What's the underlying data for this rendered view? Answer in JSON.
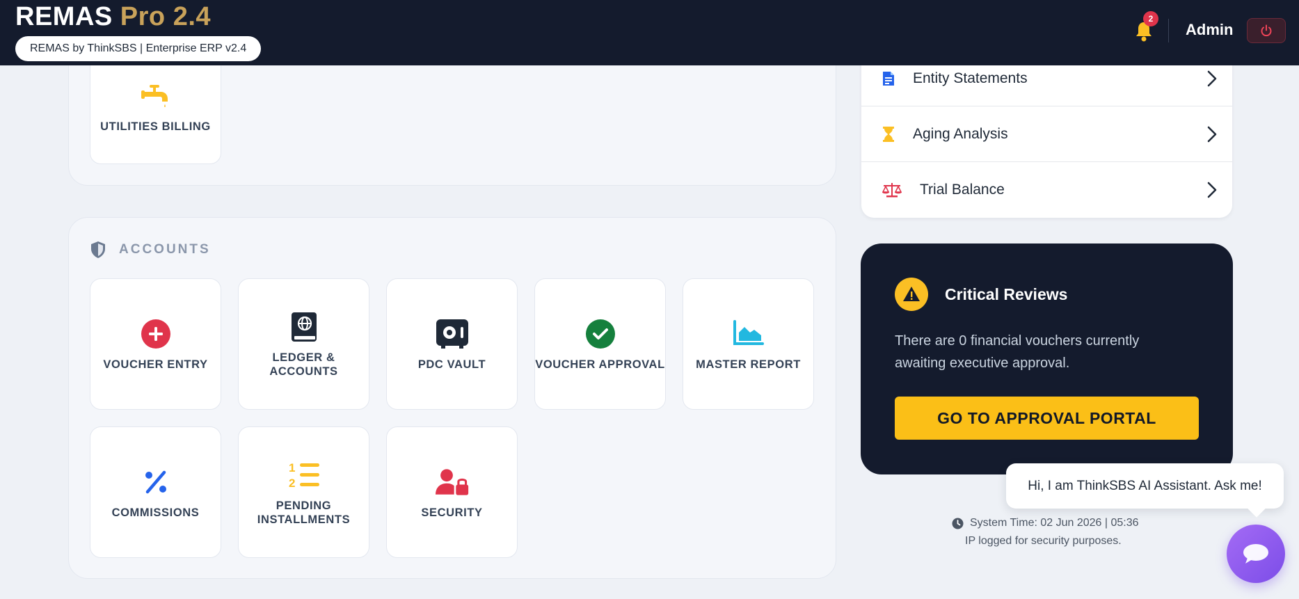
{
  "header": {
    "brand_name": "REMAS",
    "brand_version": "Pro 2.4",
    "brand_subtitle": "REMAS by ThinkSBS | Enterprise ERP v2.4",
    "notification_count": "2",
    "user_name": "Admin"
  },
  "top_section": {
    "tiles": [
      {
        "label": "UTILITIES BILLING",
        "icon": "faucet-icon",
        "color": "#fbbf24"
      }
    ]
  },
  "accounts": {
    "title": "ACCOUNTS",
    "icon": "shield-icon",
    "tiles": [
      {
        "label": "VOUCHER ENTRY",
        "icon": "plus-circle-icon",
        "color": "#e0344b"
      },
      {
        "label": "LEDGER & ACCOUNTS",
        "icon": "book-icon",
        "color": "#1f2937"
      },
      {
        "label": "PDC VAULT",
        "icon": "vault-icon",
        "color": "#1f2937"
      },
      {
        "label": "VOUCHER APPROVAL",
        "icon": "check-circle-icon",
        "color": "#15803d"
      },
      {
        "label": "MASTER REPORT",
        "icon": "area-chart-icon",
        "color": "#22b8e0"
      },
      {
        "label": "COMMISSIONS",
        "icon": "percent-icon",
        "color": "#2563eb"
      },
      {
        "label": "PENDING INSTALLMENTS",
        "icon": "numbered-list-icon",
        "color": "#fbbf24"
      },
      {
        "label": "SECURITY",
        "icon": "user-lock-icon",
        "color": "#e0344b"
      }
    ]
  },
  "reports_list": {
    "items": [
      {
        "label": "Entity Statements",
        "icon": "document-icon",
        "color": "#2563eb"
      },
      {
        "label": "Aging Analysis",
        "icon": "hourglass-icon",
        "color": "#fbbf24"
      },
      {
        "label": "Trial Balance",
        "icon": "scale-icon",
        "color": "#e0344b"
      }
    ]
  },
  "critical_reviews": {
    "title": "Critical Reviews",
    "message": "There are 0 financial vouchers currently awaiting executive approval.",
    "button_label": "GO TO APPROVAL PORTAL"
  },
  "chat": {
    "greeting": "Hi, I am ThinkSBS AI Assistant. Ask me!"
  },
  "footer": {
    "system_time": "System Time: 02 Jun 2026 | 05:36",
    "ip_note": "IP logged for security purposes."
  }
}
